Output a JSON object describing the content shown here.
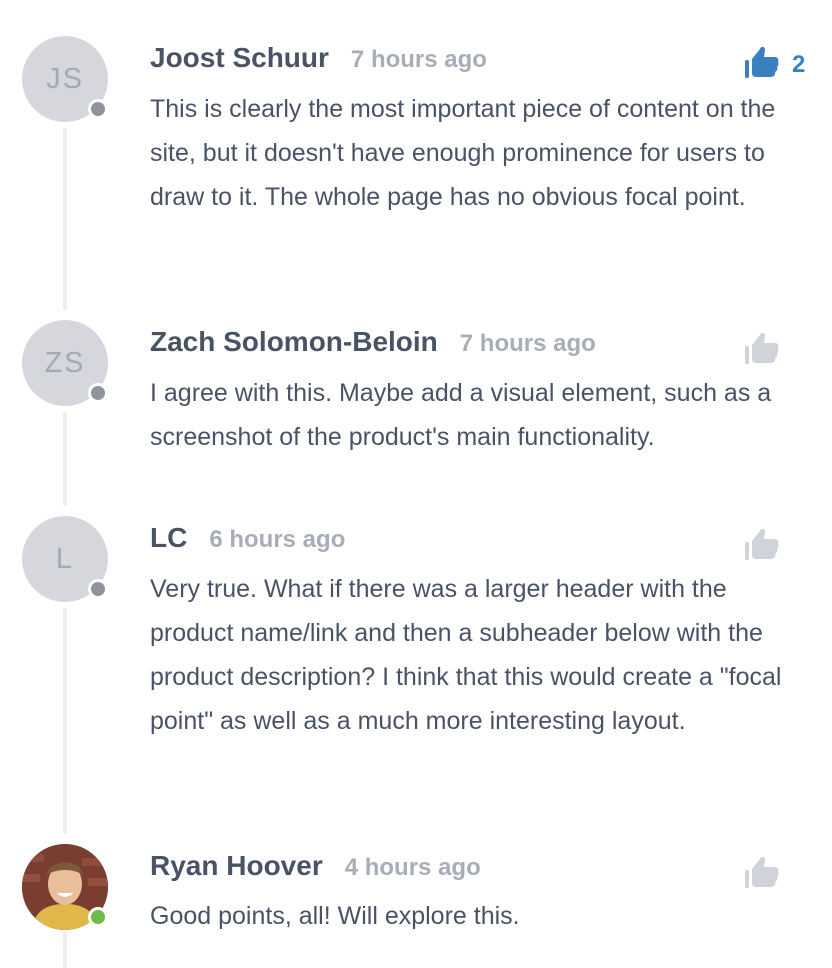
{
  "comments": [
    {
      "initials": "JS",
      "author": "Joost Schuur",
      "time": "7 hours ago",
      "text": "This is clearly the most important piece of content on the site, but it doesn't have enough prominence for users to draw to it. The whole page has no obvious focal point.",
      "upvotes": "2",
      "upvoted": true,
      "presence": "offline"
    },
    {
      "initials": "ZS",
      "author": "Zach Solomon-Beloin",
      "time": "7 hours ago",
      "text": "I agree with this. Maybe add a visual element, such as a screenshot of the product's main functionality.",
      "upvoted": false,
      "presence": "offline"
    },
    {
      "initials": "L",
      "author": "LC",
      "time": "6 hours ago",
      "text": "Very true. What if there was a larger header with the product name/link and then a subheader below with the product description? I think that this would create a \"focal point\" as well as a much more interesting layout.",
      "upvoted": false,
      "presence": "offline"
    },
    {
      "initials": "",
      "author": "Ryan Hoover",
      "time": "4 hours ago",
      "text": "Good points, all! Will explore this.",
      "upvoted": false,
      "presence": "online"
    }
  ],
  "icons": {
    "upvote": "thumbs-up-icon"
  },
  "colors": {
    "upvote_active": "#3a80be",
    "upvote_inactive": "#d0d3d9",
    "presence_offline": "#8f949c",
    "presence_online": "#6dbb4a",
    "thread_line": "#ecedf1"
  }
}
